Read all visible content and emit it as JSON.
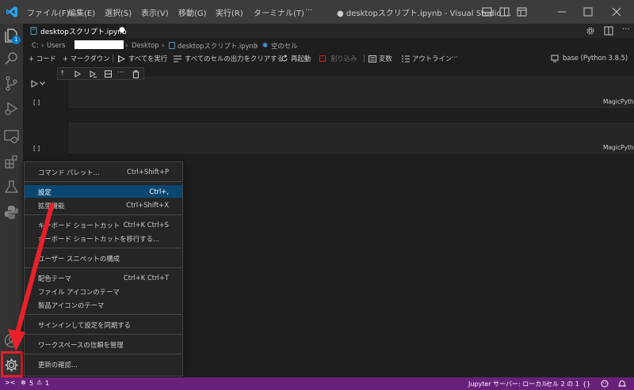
{
  "menubar": {
    "items": [
      "ファイル(F)",
      "編集(E)",
      "選択(S)",
      "表示(V)",
      "移動(G)",
      "実行(R)",
      "ターミナル(T)",
      "···"
    ],
    "window_title": "● desktopスクリプト.ipynb - Visual Studio ..."
  },
  "activity": {
    "explorer_badge": "1"
  },
  "tab": {
    "label": "desktopスクリプト.ipynb",
    "dirty": "●"
  },
  "breadcrumb": {
    "items": [
      "C:",
      "Users",
      "",
      "Desktop",
      "desktopスクリプト.ipynb",
      "空のセル"
    ]
  },
  "toolbar": {
    "code": "+ コード",
    "markdown": "+ マークダウン",
    "run_all": "すべてを実行",
    "clear_outputs": "すべてのセルの出力をクリアする",
    "restart": "再起動",
    "interrupt": "割り込み",
    "variables": "変数",
    "outline": "アウトライン",
    "more": "···",
    "kernel": "base (Python 3.8.5)"
  },
  "cells": [
    {
      "exec": "[ ]",
      "language": "MagicPython"
    },
    {
      "exec": "[ ]",
      "language": "MagicPython"
    }
  ],
  "context_menu": {
    "groups": [
      [
        {
          "label": "コマンド パレット...",
          "key": "Ctrl+Shift+P"
        }
      ],
      [
        {
          "label": "設定",
          "key": "Ctrl+,",
          "selected": true
        },
        {
          "label": "拡張機能",
          "key": "Ctrl+Shift+X"
        }
      ],
      [
        {
          "label": "キーボード ショートカット",
          "key": "Ctrl+K Ctrl+S"
        },
        {
          "label": "キーボード ショートカットを移行する...",
          "key": ""
        }
      ],
      [
        {
          "label": "ユーザー スニペットの構成",
          "key": ""
        }
      ],
      [
        {
          "label": "配色テーマ",
          "key": "Ctrl+K Ctrl+T"
        },
        {
          "label": "ファイル アイコンのテーマ",
          "key": ""
        },
        {
          "label": "製品アイコンのテーマ",
          "key": ""
        }
      ],
      [
        {
          "label": "サインインして設定を同期する",
          "key": ""
        }
      ],
      [
        {
          "label": "ワークスペースの信頼を管理",
          "key": ""
        }
      ],
      [
        {
          "label": "更新の確認...",
          "key": ""
        }
      ]
    ]
  },
  "statusbar": {
    "remote": "><",
    "errors": "5",
    "warnings": "1",
    "jupyter": "Jupyter サーバー: ローカル",
    "cell_pos": "セル 2 の 1"
  },
  "colors": {
    "accent": "#007acc",
    "statusbar": "#68217a",
    "selection": "#094771",
    "annotation": "#e8202a"
  }
}
